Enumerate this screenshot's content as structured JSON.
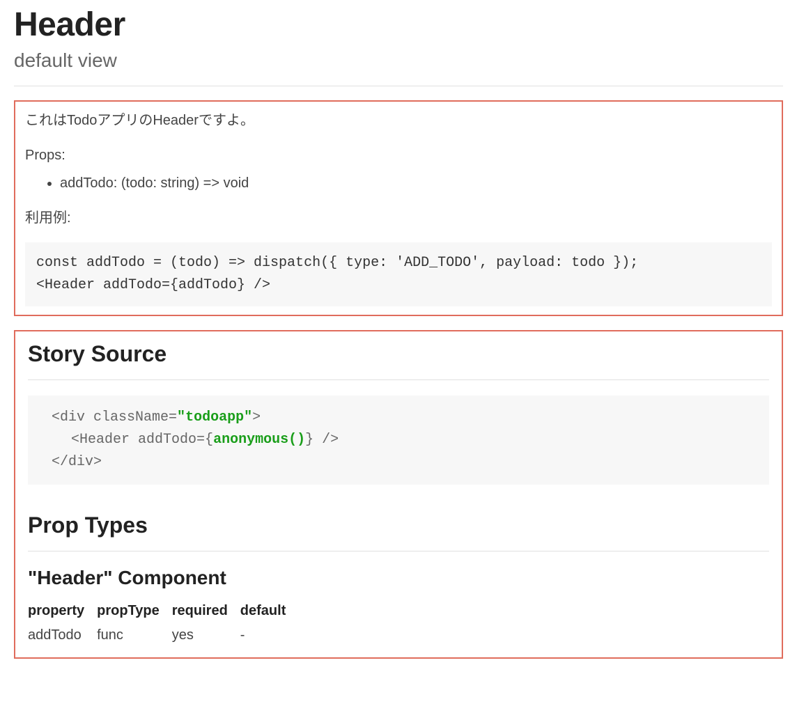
{
  "header": {
    "title": "Header",
    "subtitle": "default view"
  },
  "info": {
    "line1": "これはTodoアプリのHeaderですよ。",
    "props_label": "Props:",
    "props_item": "addTodo: (todo: string) => void",
    "usage_label": "利用例:",
    "code": "const addTodo = (todo) => dispatch({ type: 'ADD_TODO', payload: todo });\n<Header addTodo={addTodo} />"
  },
  "story_source": {
    "heading": "Story Source",
    "code_tokens": {
      "l1_open": "<div",
      "l1_attr": " className=",
      "l1_strq": "\"",
      "l1_str": "todoapp",
      "l1_close": ">",
      "l2_open": "<Header",
      "l2_attr": " addTodo=",
      "l2_lbrace": "{",
      "l2_fn": "anonymous()",
      "l2_rbrace": "}",
      "l2_close": " />",
      "l3": "</div>"
    }
  },
  "prop_types": {
    "heading": "Prop Types",
    "component_heading": "\"Header\" Component",
    "columns": {
      "c0": "property",
      "c1": "propType",
      "c2": "required",
      "c3": "default"
    },
    "rows": [
      {
        "property": "addTodo",
        "propType": "func",
        "required": "yes",
        "default": "-"
      }
    ]
  }
}
